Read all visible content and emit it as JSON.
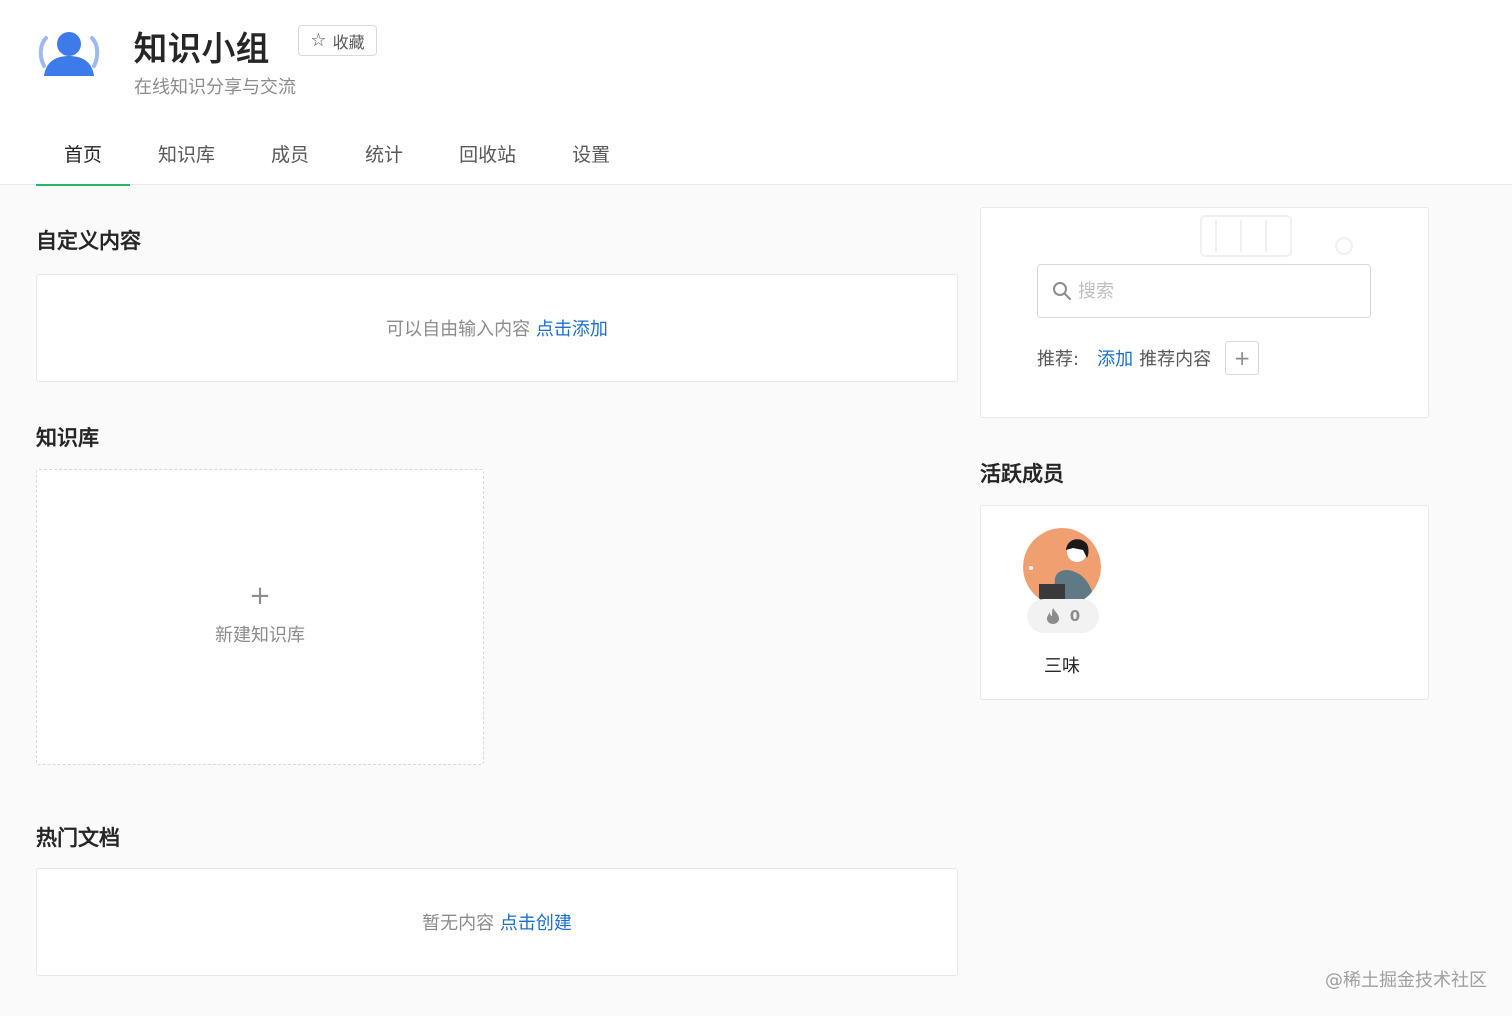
{
  "group": {
    "title": "知识小组",
    "subtitle": "在线知识分享与交流",
    "favorite_label": "收藏",
    "favorite_icon": "star-outline-icon",
    "avatar_icon": "user-group-icon",
    "avatar_color": "#3e7bea"
  },
  "tabs": [
    {
      "label": "首页",
      "active": true
    },
    {
      "label": "知识库"
    },
    {
      "label": "成员"
    },
    {
      "label": "统计"
    },
    {
      "label": "回收站"
    },
    {
      "label": "设置"
    }
  ],
  "custom_content": {
    "title": "自定义内容",
    "empty_text": "可以自由输入内容",
    "action": "点击添加"
  },
  "knowledge_base": {
    "title": "知识库",
    "new_label": "新建知识库",
    "new_icon": "plus-icon"
  },
  "hot_docs": {
    "title": "热门文档",
    "empty_text": "暂无内容",
    "action": "点击创建"
  },
  "search": {
    "placeholder": "搜索",
    "icon": "search-icon",
    "recommend_label": "推荐:",
    "recommend_action": "添加",
    "recommend_text": "推荐内容",
    "add_icon": "plus-icon"
  },
  "active_members": {
    "title": "活跃成员",
    "members": [
      {
        "name": "三味",
        "heat": "0",
        "heat_icon": "flame-icon"
      }
    ]
  },
  "watermark": "@稀土掘金技术社区",
  "colors": {
    "accent": "#25b864",
    "link": "#1a6fce",
    "avatar_bg": "#f0a070"
  }
}
